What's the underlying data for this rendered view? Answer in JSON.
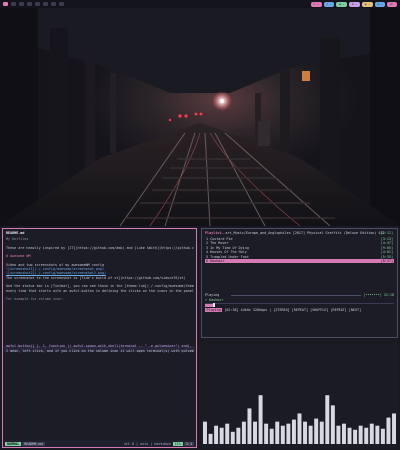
{
  "topbar": {
    "workspaces": [
      {
        "active": true
      },
      {
        "active": false
      },
      {
        "active": false
      },
      {
        "active": false
      },
      {
        "active": false
      },
      {
        "active": false
      },
      {
        "active": false
      },
      {
        "active": false
      }
    ],
    "widgets": [
      {
        "icon": "☾",
        "text": "—",
        "color": "#e07ab3"
      },
      {
        "icon": "♪",
        "text": "—",
        "color": "#6aa7e6"
      },
      {
        "icon": "◉",
        "text": "—",
        "color": "#7fcfa0"
      },
      {
        "icon": "⚙",
        "text": "—",
        "color": "#c9a0e8"
      },
      {
        "icon": "▤",
        "text": "—",
        "color": "#e6c27a"
      },
      {
        "icon": "◷",
        "text": "—",
        "color": "#6aa7e6"
      },
      {
        "icon": "⏻",
        "text": "",
        "color": "#e07ab3"
      }
    ]
  },
  "editor": {
    "file_title": "README.md",
    "lines": [
      {
        "cls": "c-dim",
        "text": "  My Dotfiles"
      },
      {
        "cls": "c-txt",
        "text": ""
      },
      {
        "cls": "c-txt",
        "text": "These are heavily inspired by [IT](https://github.com/dmb) and [Luke Smith](https://github.com/LukeSmithxyz)"
      },
      {
        "cls": "c-txt",
        "text": ""
      },
      {
        "cls": "c-head",
        "text": "# Awesome WM"
      },
      {
        "cls": "c-txt",
        "text": ""
      },
      {
        "cls": "c-txt",
        "text": "Video and two screenshots of my awesomeWM config"
      },
      {
        "cls": "c-link",
        "text": "![screenshot1](./.config/awesome/screenshot.png)"
      },
      {
        "cls": "c-link",
        "text": "![screenshot2](./.config/awesome/screenshot2.png)"
      },
      {
        "cls": "c-txt",
        "text": "The screenshot to the screenshot is [Tide's build of st](https://github.com/siduck76/st)"
      },
      {
        "cls": "c-txt",
        "text": ""
      },
      {
        "cls": "c-txt",
        "text": "And the status bar is [Tintbar], you can see those in the [theme.lua](./.config/awesome/theme.lua)"
      },
      {
        "cls": "c-txt",
        "text": "every time that starts with an awful.button in defining the clicks on the icons in the panel"
      },
      {
        "cls": "c-txt",
        "text": ""
      },
      {
        "cls": "c-dim",
        "text": "For example for volume icon:"
      },
      {
        "cls": "c-txt",
        "text": ""
      },
      {
        "cls": "c-txt",
        "text": ""
      },
      {
        "cls": "c-txt",
        "text": ""
      },
      {
        "cls": "c-txt",
        "text": ""
      },
      {
        "cls": "c-txt",
        "text": ""
      },
      {
        "cls": "c-txt",
        "text": ""
      },
      {
        "cls": "c-txt",
        "text": ""
      },
      {
        "cls": "c-txt",
        "text": ""
      },
      {
        "cls": "c-txt",
        "text": ""
      },
      {
        "cls": "c-txt",
        "text": ""
      },
      {
        "cls": "c-txt",
        "text": "I mean, left click, and if you click on the volume icon it will open terminal(s) with pulsemixer"
      }
    ],
    "code_line": "   awful.button({ }, 1, function () awful.spawn.with_shell(terminal .. \" -e pulsemixer\") end),",
    "status": {
      "mode": "NORMAL",
      "branch": "README.md",
      "filetype": "utf-8 | unix | markdown",
      "percent": "11%",
      "position": "1:1"
    }
  },
  "player": {
    "label": "Playlist",
    "title_prefix": "— art_Music/Europe_and_Anglophiles [2017] Physical Graffiti (Deluxe Edition) 432",
    "duration": "[1:12]",
    "tracks": [
      {
        "name": "1 Custard Pie",
        "time": "[3:13]",
        "playing": false
      },
      {
        "name": "2 The Rover",
        "time": "[4:47]",
        "playing": false
      },
      {
        "name": "3 In My Time Of Dying",
        "time": "[9:05]",
        "playing": false
      },
      {
        "name": "4 Houses Of The Holy",
        "time": "[4:01]",
        "playing": false
      },
      {
        "name": "5 Trampled Under Foot",
        "time": "[5:35]",
        "playing": false
      },
      {
        "name": "6 Kashmir",
        "time": "[8:37]",
        "playing": true
      }
    ],
    "tab_browse": "Playing",
    "tab_playlist": "",
    "tab_stats": "[•••••••] 32:18",
    "now_playing": "> Kashmir",
    "progress": 0.05,
    "info_tag": "Playing",
    "info_text": " [02:38] 44kHz 320kbps | [STEREO] [REPEAT] [SHUFFLE] [REPEAT] [NEXT]"
  },
  "visualizer": {
    "bar_values": [
      0.22,
      0.1,
      0.18,
      0.16,
      0.2,
      0.12,
      0.16,
      0.22,
      0.35,
      0.22,
      0.48,
      0.2,
      0.15,
      0.22,
      0.18,
      0.2,
      0.24,
      0.3,
      0.22,
      0.18,
      0.25,
      0.22,
      0.48,
      0.38,
      0.18,
      0.2,
      0.16,
      0.14,
      0.18,
      0.16,
      0.2,
      0.18,
      0.15,
      0.26,
      0.3
    ],
    "bar_color": "#d8d8e2"
  },
  "colors": {
    "accent": "#e07ab3",
    "green": "#7fcfa0",
    "background": "#191922"
  }
}
